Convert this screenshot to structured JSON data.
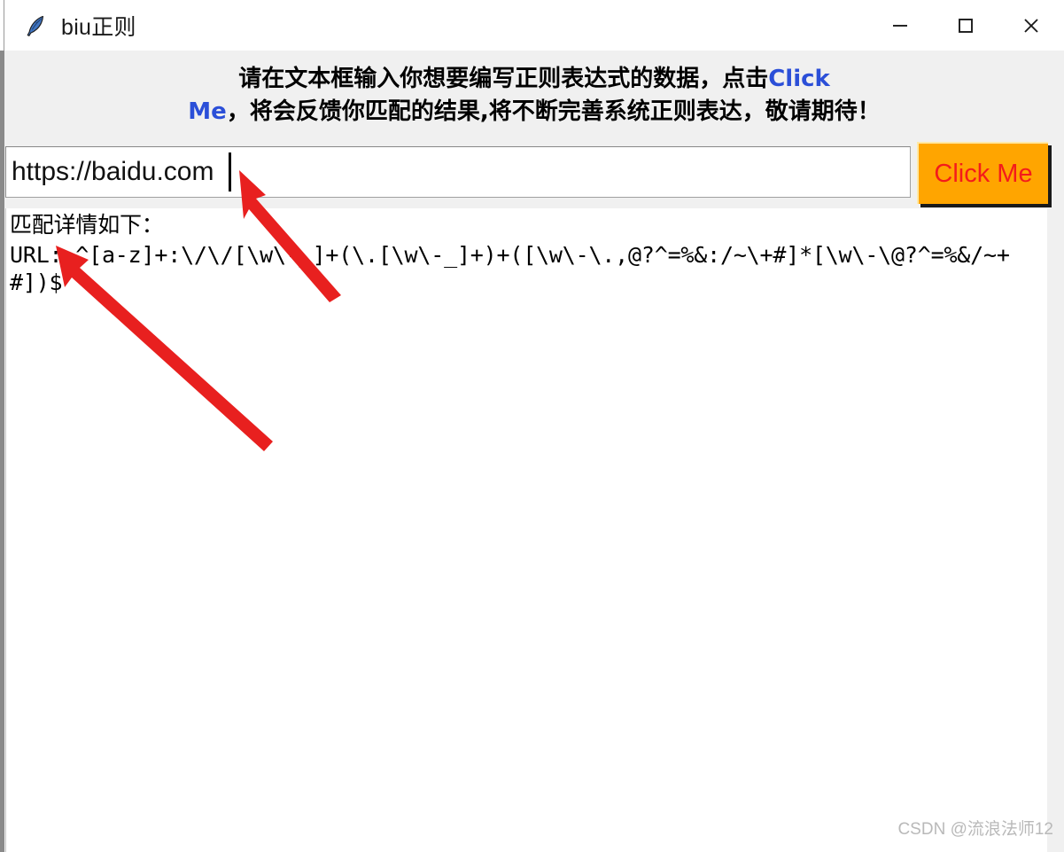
{
  "window": {
    "title": "biu正则",
    "icon": "feather-icon",
    "controls": [
      {
        "name": "minimize-button",
        "glyph": "minimize-icon"
      },
      {
        "name": "maximize-button",
        "glyph": "maximize-icon"
      },
      {
        "name": "close-button",
        "glyph": "close-icon"
      }
    ]
  },
  "header": {
    "line1_part1": "请在文本框输入你想要编写正则表达式的数据，点击",
    "line1_part2": "Click",
    "line2_part1": "Me",
    "line2_part2": "，将会反馈你匹配的结果,将不断完善系统正则表达，敬请期待！",
    "accent_color": "#2b4fd8"
  },
  "input": {
    "value": "https://baidu.com",
    "placeholder": "",
    "caret_visible": true
  },
  "button": {
    "label": "Click Me",
    "background_color": "#ffa500",
    "text_color": "#f41b1b"
  },
  "result": {
    "heading": "匹配详情如下：",
    "body": "URL: ^[a-z]+:\\/\\/[\\w\\-_]+(\\.[\\w\\-_]+)+([\\w\\-\\.,@?^=%&:/~\\+#]*[\\w\\-\\@?^=%&/~+#])$"
  },
  "watermark": {
    "text": "CSDN @流浪法师12"
  },
  "annotations": {
    "arrow1": {
      "name": "arrow-to-input-caret",
      "color": "#e8201f"
    },
    "arrow2": {
      "name": "arrow-to-url-label",
      "color": "#e8201f"
    }
  }
}
